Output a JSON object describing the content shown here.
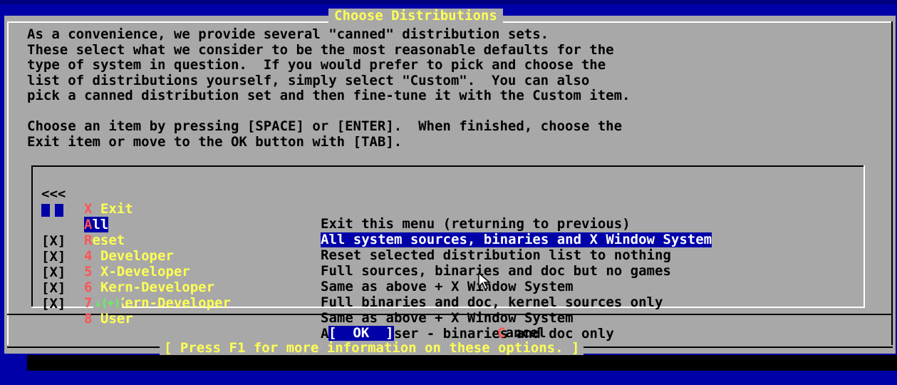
{
  "dialog": {
    "title": "Choose Distributions",
    "intro_lines": [
      "As a convenience, we provide several \"canned\" distribution sets.",
      "These select what we consider to be the most reasonable defaults for the",
      "type of system in question.  If you would prefer to pick and choose the",
      "list of distributions yourself, simply select \"Custom\".  You can also",
      "pick a canned distribution set and then fine-tune it with the Custom item.",
      "",
      "Choose an item by pressing [SPACE] or [ENTER].  When finished, choose the",
      "Exit item or move to the OK button with [TAB]."
    ]
  },
  "menu": {
    "items": [
      {
        "mark": "<<<",
        "hotkey": "X",
        "label": " Exit",
        "description": "Exit this menu (returning to previous)"
      },
      {
        "mark": "",
        "hotkey": "A",
        "label": "ll",
        "description": "All system sources, binaries and X Window System"
      },
      {
        "mark": "",
        "hotkey": "R",
        "label": "eset",
        "description": "Reset selected distribution list to nothing"
      },
      {
        "mark": "[X]",
        "hotkey": "4",
        "label": " Developer",
        "description": "Full sources, binaries and doc but no games"
      },
      {
        "mark": "[X]",
        "hotkey": "5",
        "label": " X-Developer",
        "description": "Same as above + X Window System"
      },
      {
        "mark": "[X]",
        "hotkey": "6",
        "label": " Kern-Developer",
        "description": "Full binaries and doc, kernel sources only"
      },
      {
        "mark": "[X]",
        "hotkey": "7",
        "label": " X-Kern-Developer",
        "description": "Same as above + X Window System"
      },
      {
        "mark": "[X]",
        "hotkey": "8",
        "label": " User",
        "description": "Average user - binaries and doc only"
      }
    ],
    "more_indicator": "↓(+)"
  },
  "buttons": {
    "ok_label": "[  OK  ]",
    "cancel_hotkey": "C",
    "cancel_rest": "ancel"
  },
  "help_line": "[ Press F1 for more information on these options. ]"
}
